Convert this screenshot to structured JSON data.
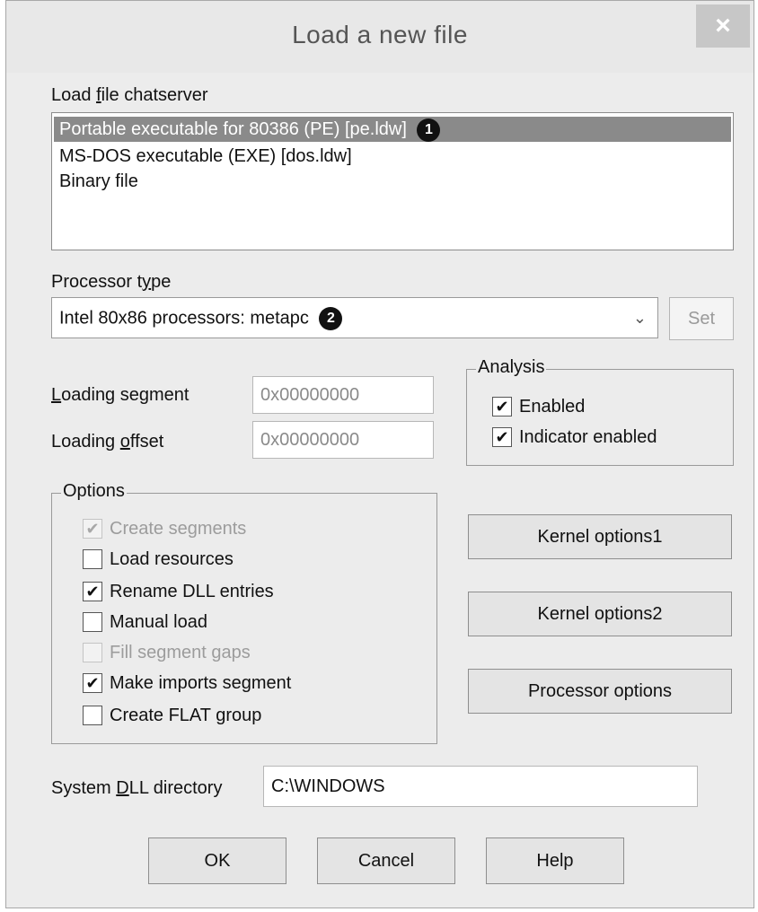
{
  "window": {
    "title": "Load a new file",
    "close_glyph": "×"
  },
  "load_file": {
    "label_prefix": "Load ",
    "label_u": "f",
    "label_suffix": "ile chatserver",
    "items": [
      {
        "label": "Portable executable for 80386 (PE) [pe.ldw]",
        "selected": true,
        "marker": "1"
      },
      {
        "label": "MS-DOS executable (EXE) [dos.ldw]"
      },
      {
        "label": "Binary file"
      }
    ]
  },
  "processor": {
    "label_prefix": "Processor t",
    "label_u": "y",
    "label_suffix": "pe",
    "value": "Intel 80x86 processors: metapc",
    "marker": "2",
    "arrow": "⌄",
    "set_label": "Set"
  },
  "loading": {
    "segment_u": "L",
    "segment_rest": "oading segment",
    "segment_value": "0x00000000",
    "offset_prefix": "Loading ",
    "offset_u": "o",
    "offset_suffix": "ffset",
    "offset_value": "0x00000000"
  },
  "analysis": {
    "title": "Analysis",
    "items": [
      {
        "label": "Enabled",
        "checked": true
      },
      {
        "label": "Indicator enabled",
        "checked": true
      }
    ]
  },
  "options": {
    "title": "Options",
    "items": [
      {
        "label": "Create segments",
        "checked": true,
        "disabled": true
      },
      {
        "label": "Load resources",
        "checked": false
      },
      {
        "label": "Rename DLL entries",
        "checked": true
      },
      {
        "label": "Manual load",
        "checked": false
      },
      {
        "label": "Fill segment gaps",
        "checked": false,
        "disabled": true
      },
      {
        "label": "Make imports segment",
        "checked": true
      },
      {
        "label": "Create FLAT group",
        "checked": false
      }
    ]
  },
  "side_buttons": {
    "kernel1": "Kernel options1",
    "kernel2": "Kernel options2",
    "processor": "Processor options"
  },
  "system_dll": {
    "label_prefix": "System ",
    "label_u": "D",
    "label_suffix": "LL directory",
    "value": "C:\\WINDOWS"
  },
  "footer": {
    "ok": "OK",
    "cancel": "Cancel",
    "help": "Help"
  },
  "check_glyph": "✔"
}
